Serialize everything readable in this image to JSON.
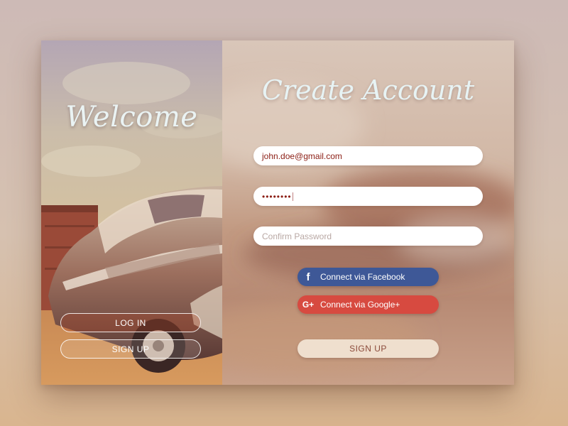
{
  "welcome": {
    "title": "Welcome",
    "login_label": "LOG IN",
    "signup_label": "SIGN UP"
  },
  "form": {
    "title": "Create Account",
    "email_value": "john.doe@gmail.com",
    "password_value": "••••••••",
    "confirm_placeholder": "Confirm Password",
    "facebook_label": "Connect via Facebook",
    "google_label": "Connect via Google+",
    "signup_label": "SIGN UP"
  },
  "icons": {
    "facebook": "facebook-icon",
    "google": "google-plus-icon"
  },
  "colors": {
    "facebook": "#3e5897",
    "google": "#d74a40",
    "signup_bg": "#efdfce",
    "input_text": "#8b1d14",
    "title_text": "#e7f3f4"
  }
}
